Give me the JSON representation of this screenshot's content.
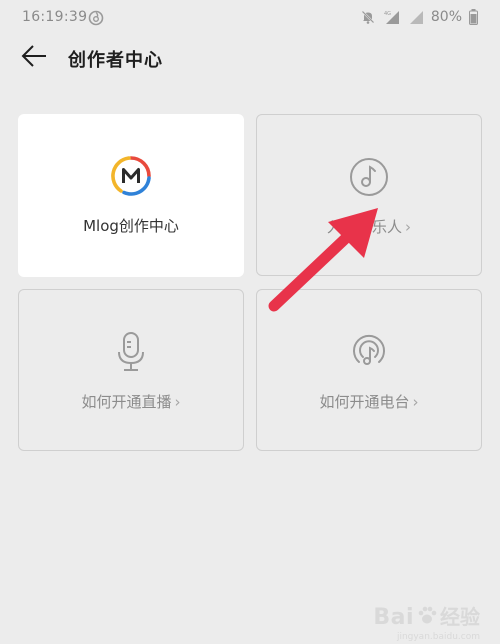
{
  "status_bar": {
    "time": "16:19:39",
    "battery": "80%"
  },
  "header": {
    "title": "创作者中心"
  },
  "cards": {
    "mlog": {
      "label": "Mlog创作中心"
    },
    "musician": {
      "label": "入驻音乐人",
      "chevron": "›"
    },
    "live": {
      "label": "如何开通直播",
      "chevron": "›"
    },
    "radio": {
      "label": "如何开通电台",
      "chevron": "›"
    }
  },
  "watermark": {
    "brand": "Bai",
    "cn": "经验",
    "url": "jingyan.baidu.com"
  },
  "colors": {
    "accent_arrow": "#e8334a",
    "mlog_red": "#e84a3d",
    "mlog_blue": "#2f82d8",
    "mlog_yellow": "#f3b52a",
    "background": "#ececec"
  },
  "icons": {
    "back": "arrow-left-icon",
    "mlog": "mlog-logo-icon",
    "musician": "music-note-icon",
    "live": "microphone-icon",
    "radio": "podcast-icon"
  }
}
